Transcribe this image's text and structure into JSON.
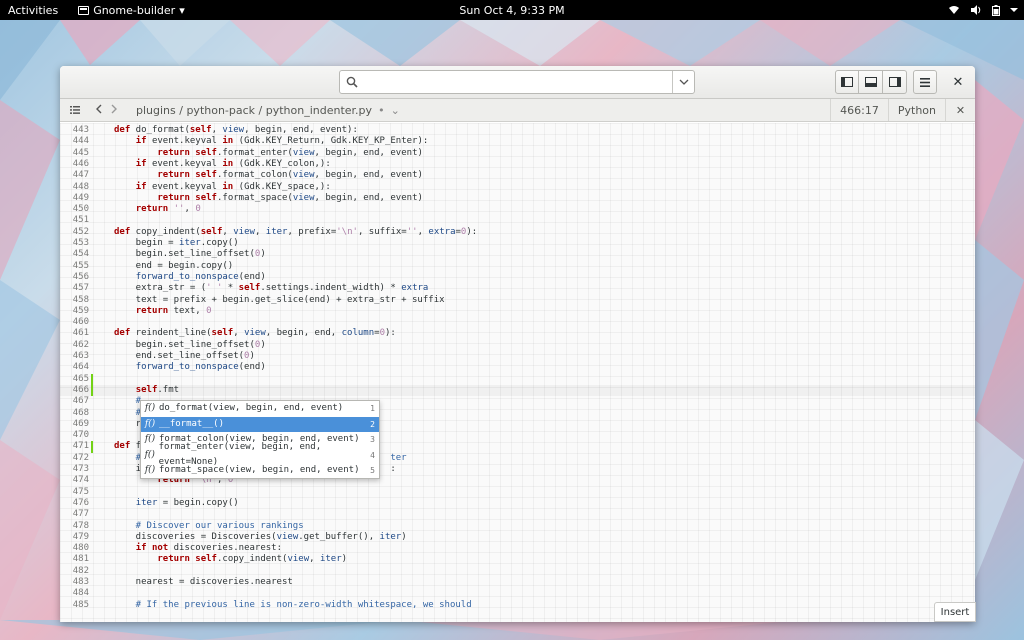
{
  "topbar": {
    "activities": "Activities",
    "app_name": "Gnome-builder",
    "app_menu_arrow": "▾",
    "clock": "Sun Oct  4,  9:33 PM",
    "tray_icons": [
      "wifi-icon",
      "volume-icon",
      "battery-icon",
      "system-menu-icon"
    ]
  },
  "headerbar": {
    "search_placeholder": "",
    "close_glyph": "✕"
  },
  "docbar": {
    "breadcrumb": "plugins / python-pack / python_indenter.py",
    "modified_marker": "•",
    "dropdown_glyph": "⌄",
    "cursor_position": "466:17",
    "language": "Python",
    "close_glyph": "✕"
  },
  "editor": {
    "lines": [
      {
        "n": "443",
        "text": "def do_format(self, view, begin, end, event):"
      },
      {
        "n": "444",
        "text": "    if event.keyval in (Gdk.KEY_Return, Gdk.KEY_KP_Enter):"
      },
      {
        "n": "445",
        "text": "        return self.format_enter(view, begin, end, event)"
      },
      {
        "n": "446",
        "text": "    if event.keyval in (Gdk.KEY_colon,):"
      },
      {
        "n": "447",
        "text": "        return self.format_colon(view, begin, end, event)"
      },
      {
        "n": "448",
        "text": "    if event.keyval in (Gdk.KEY_space,):"
      },
      {
        "n": "449",
        "text": "        return self.format_space(view, begin, end, event)"
      },
      {
        "n": "450",
        "text": "    return '', 0"
      },
      {
        "n": "451",
        "text": ""
      },
      {
        "n": "452",
        "text": "def copy_indent(self, view, iter, prefix='\\n', suffix='', extra=0):"
      },
      {
        "n": "453",
        "text": "    begin = iter.copy()"
      },
      {
        "n": "454",
        "text": "    begin.set_line_offset(0)"
      },
      {
        "n": "455",
        "text": "    end = begin.copy()"
      },
      {
        "n": "456",
        "text": "    forward_to_nonspace(end)"
      },
      {
        "n": "457",
        "text": "    extra_str = (' ' * self.settings.indent_width) * extra"
      },
      {
        "n": "458",
        "text": "    text = prefix + begin.get_slice(end) + extra_str + suffix"
      },
      {
        "n": "459",
        "text": "    return text, 0"
      },
      {
        "n": "460",
        "text": ""
      },
      {
        "n": "461",
        "text": "def reindent_line(self, view, begin, end, column=0):"
      },
      {
        "n": "462",
        "text": "    begin.set_line_offset(0)"
      },
      {
        "n": "463",
        "text": "    end.set_line_offset(0)"
      },
      {
        "n": "464",
        "text": "    forward_to_nonspace(end)"
      },
      {
        "n": "465",
        "text": ""
      },
      {
        "n": "466",
        "text": "    self.fmt"
      },
      {
        "n": "467",
        "text": "    #"
      },
      {
        "n": "468",
        "text": "    #"
      },
      {
        "n": "469",
        "text": "    r"
      },
      {
        "n": "470",
        "text": ""
      },
      {
        "n": "471",
        "text": "def f"
      },
      {
        "n": "472",
        "text": "    #                                              ter"
      },
      {
        "n": "473",
        "text": "    i                                              :"
      },
      {
        "n": "474",
        "text": "        return '\\n', 0"
      },
      {
        "n": "475",
        "text": ""
      },
      {
        "n": "476",
        "text": "    iter = begin.copy()"
      },
      {
        "n": "477",
        "text": ""
      },
      {
        "n": "478",
        "text": "    # Discover our various rankings"
      },
      {
        "n": "479",
        "text": "    discoveries = Discoveries(view.get_buffer(), iter)"
      },
      {
        "n": "480",
        "text": "    if not discoveries.nearest:"
      },
      {
        "n": "481",
        "text": "        return self.copy_indent(view, iter)"
      },
      {
        "n": "482",
        "text": ""
      },
      {
        "n": "483",
        "text": "    nearest = discoveries.nearest"
      },
      {
        "n": "484",
        "text": ""
      },
      {
        "n": "485",
        "text": "    # If the previous line is non-zero-width whitespace, we should"
      }
    ],
    "current_line": "466",
    "modified_lines": [
      "465",
      "466",
      "471"
    ]
  },
  "completion": {
    "icon_glyph": "f()",
    "items": [
      {
        "label": "do_format(view, begin, end, event)",
        "key": "1"
      },
      {
        "label": "__format__()",
        "key": "2"
      },
      {
        "label": "format_colon(view, begin, end, event)",
        "key": "3"
      },
      {
        "label": "format_enter(view, begin, end, event=None)",
        "key": "4"
      },
      {
        "label": "format_space(view, begin, end, event)",
        "key": "5"
      }
    ],
    "selected_index": 1
  },
  "statusbar": {
    "mode": "Insert"
  },
  "colors": {
    "selection": "#4a90d9",
    "modified_marker": "#73d216",
    "keyword": "#a40000",
    "self_keyword": "#a40000",
    "builtin": "#204a87",
    "string": "#c4a000",
    "number": "#ad7fa8",
    "comment": "#3465a4"
  }
}
